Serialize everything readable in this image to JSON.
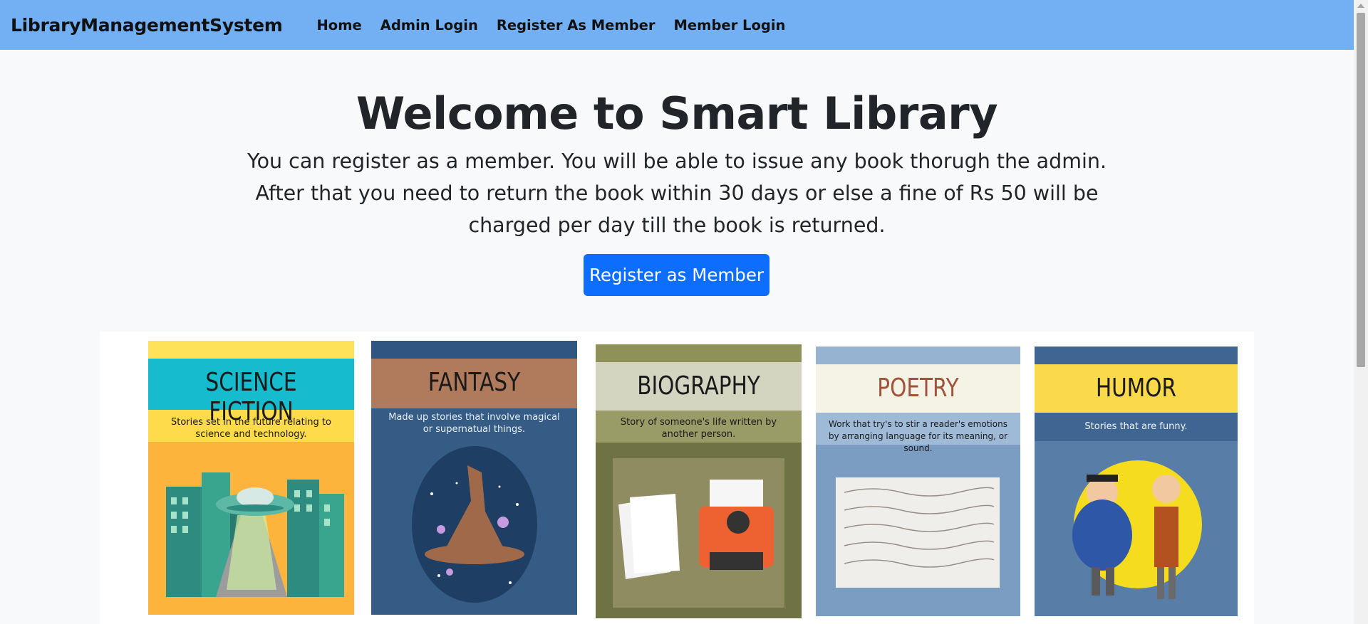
{
  "navbar": {
    "brand": "LibraryManagementSystem",
    "links": [
      "Home",
      "Admin Login",
      "Register As Member",
      "Member Login"
    ]
  },
  "hero": {
    "title": "Welcome to Smart Library",
    "description": "You can register as a member. You will be able to issue any book thorugh the admin. After that you need to return the book within 30 days or else a fine of Rs 50 will be charged per day till the book is returned.",
    "button": "Register as Member"
  },
  "genres": [
    {
      "title": "SCIENCE FICTION",
      "desc": "Stories set in the future relating to science and technology."
    },
    {
      "title": "FANTASY",
      "desc": "Made up stories that involve magical or supernatual things."
    },
    {
      "title": "BIOGRAPHY",
      "desc": "Story of someone's life written by another person."
    },
    {
      "title": "POETRY",
      "desc": "Work that try's to stir a reader's emotions by arranging language for its meaning, or sound."
    },
    {
      "title": "HUMOR",
      "desc": "Stories that are funny."
    }
  ],
  "colors": {
    "navbar": "#72b0f3",
    "primary": "#0d6efd",
    "background": "#f8f9fa"
  }
}
